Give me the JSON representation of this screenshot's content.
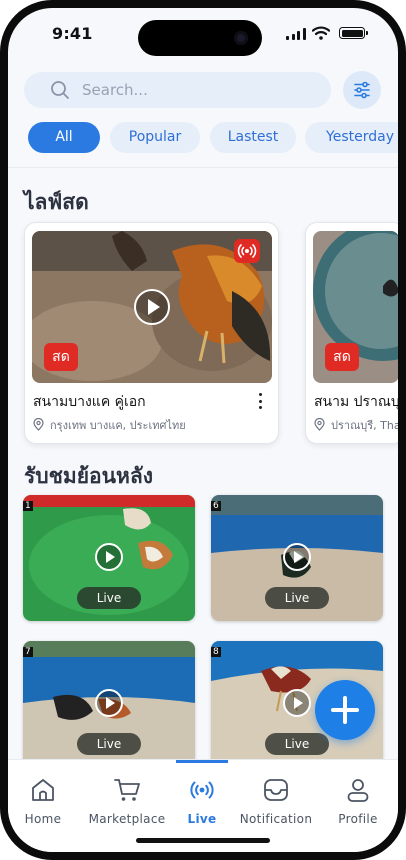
{
  "status_bar": {
    "time": "9:41"
  },
  "search": {
    "placeholder": "Search..."
  },
  "filters": {
    "chips": [
      {
        "label": "All",
        "active": true
      },
      {
        "label": "Popular",
        "active": false
      },
      {
        "label": "Lastest",
        "active": false
      },
      {
        "label": "Yesterday",
        "active": false
      }
    ]
  },
  "live_section": {
    "title": "ไลฟ์สด",
    "badge_label": "สด",
    "cards": [
      {
        "title": "สนามบางแค คู่เอก",
        "location": "กรุงเทพ บางแค, ประเทศไทย"
      },
      {
        "title": "สนาม ปราณบุรี",
        "location": "ปราณบุรี, Tha"
      }
    ]
  },
  "replay_section": {
    "title": "รับชมย้อนหลัง",
    "items": [
      {
        "number": "1",
        "label": "Live"
      },
      {
        "number": "6",
        "label": "Live"
      },
      {
        "number": "7",
        "label": "Live"
      },
      {
        "number": "8",
        "label": "Live"
      }
    ]
  },
  "bottom_nav": {
    "items": [
      {
        "label": "Home",
        "icon": "home-icon"
      },
      {
        "label": "Marketplace",
        "icon": "cart-icon"
      },
      {
        "label": "Live",
        "icon": "broadcast-icon",
        "active": true
      },
      {
        "label": "Notification",
        "icon": "inbox-icon"
      },
      {
        "label": "Profile",
        "icon": "user-icon"
      }
    ]
  },
  "colors": {
    "accent": "#2a7ae2",
    "live_red": "#e02a24",
    "chip_bg": "#e6eef9"
  }
}
